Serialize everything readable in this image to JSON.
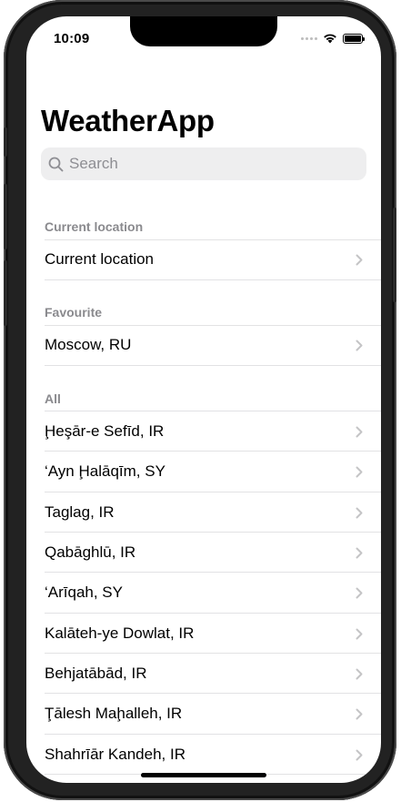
{
  "status": {
    "time": "10:09"
  },
  "app": {
    "title": "WeatherApp"
  },
  "search": {
    "placeholder": "Search"
  },
  "sections": {
    "current": {
      "header": "Current location",
      "items": [
        "Current location"
      ]
    },
    "favourite": {
      "header": "Favourite",
      "items": [
        "Moscow, RU"
      ]
    },
    "all": {
      "header": "All",
      "items": [
        "Ḩeşār-e Sefīd, IR",
        "‘Ayn Ḩalāqīm, SY",
        "Taglag, IR",
        "Qabāghlū, IR",
        "‘Arīqah, SY",
        "Kalāteh-ye Dowlat, IR",
        "Behjatābād, IR",
        "Ţālesh Maḩalleh, IR",
        "Shahrīār Kandeh, IR"
      ]
    }
  },
  "icons": {
    "search": "search-icon",
    "chevron": "chevron-right-icon",
    "wifi": "wifi-icon",
    "battery": "battery-icon",
    "signal": "signal-icon"
  },
  "colors": {
    "background": "#ffffff",
    "secondary_text": "#8a8a8e",
    "search_field": "#eeeeef",
    "chevron": "#c4c4c6"
  }
}
